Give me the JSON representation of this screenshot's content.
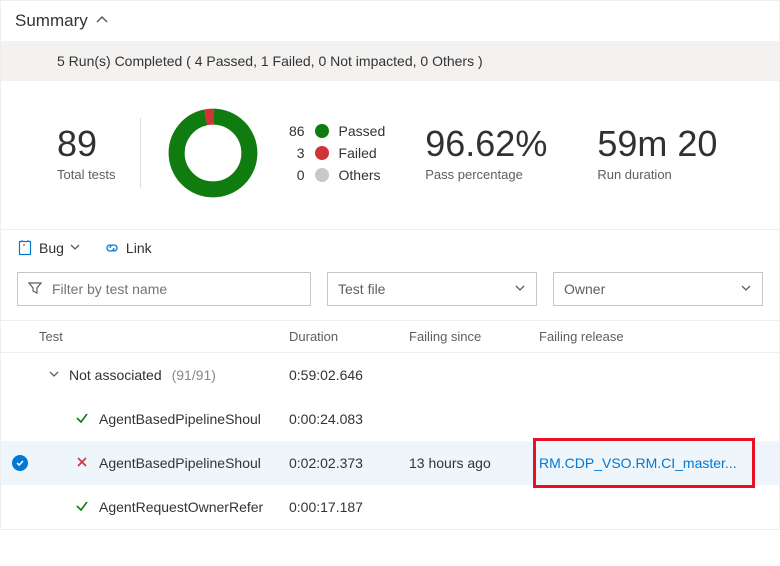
{
  "header": {
    "title": "Summary"
  },
  "status_bar": "5 Run(s) Completed ( 4 Passed, 1 Failed, 0 Not impacted, 0 Others )",
  "stats": {
    "total": {
      "value": "89",
      "label": "Total tests"
    },
    "pass_pct": {
      "value": "96.62%",
      "label": "Pass percentage"
    },
    "duration": {
      "value": "59m 20",
      "label": "Run duration"
    }
  },
  "legend": {
    "passed": {
      "count": "86",
      "label": "Passed"
    },
    "failed": {
      "count": "3",
      "label": "Failed"
    },
    "others": {
      "count": "0",
      "label": "Others"
    }
  },
  "chart_data": {
    "type": "pie",
    "title": "",
    "series": [
      {
        "name": "Passed",
        "value": 86,
        "color": "#107c10"
      },
      {
        "name": "Failed",
        "value": 3,
        "color": "#d13438"
      },
      {
        "name": "Others",
        "value": 0,
        "color": "#c8c8c8"
      }
    ]
  },
  "toolbar": {
    "bug": "Bug",
    "link": "Link"
  },
  "filters": {
    "name_placeholder": "Filter by test name",
    "file_label": "Test file",
    "owner_label": "Owner"
  },
  "columns": {
    "test": "Test",
    "duration": "Duration",
    "since": "Failing since",
    "release": "Failing release"
  },
  "group": {
    "name": "Not associated",
    "count": "(91/91)",
    "duration": "0:59:02.646"
  },
  "rows": [
    {
      "status": "pass",
      "name": "AgentBasedPipelineShoul",
      "duration": "0:00:24.083",
      "since": "",
      "release": ""
    },
    {
      "status": "fail",
      "name": "AgentBasedPipelineShoul",
      "duration": "0:02:02.373",
      "since": "13 hours ago",
      "release": "RM.CDP_VSO.RM.CI_master..."
    },
    {
      "status": "pass",
      "name": "AgentRequestOwnerRefer",
      "duration": "0:00:17.187",
      "since": "",
      "release": ""
    }
  ]
}
